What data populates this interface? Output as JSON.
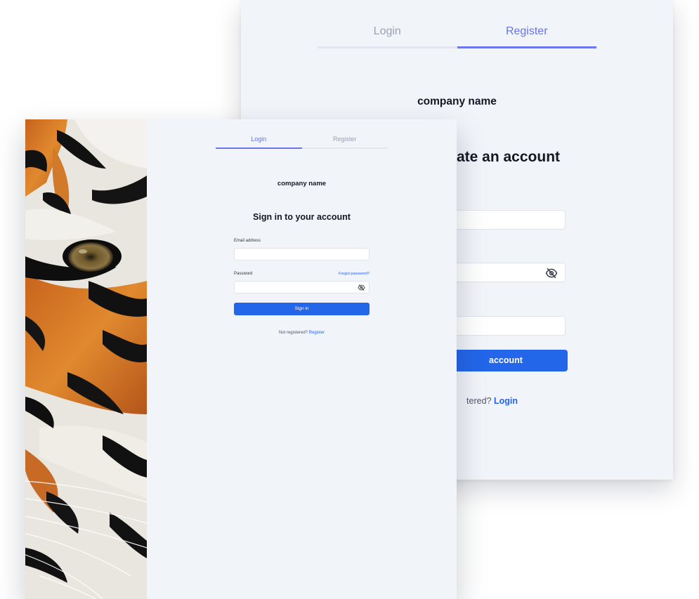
{
  "register_card": {
    "tabs": [
      "Login",
      "Register"
    ],
    "active_tab": "Register",
    "company_name": "company name",
    "heading_visible": "ate an account",
    "button_label_visible": "account",
    "footer_prefix_visible": "tered? ",
    "footer_link": "Login"
  },
  "login_card": {
    "tabs": [
      "Login",
      "Register"
    ],
    "active_tab": "Login",
    "company_name": "company name",
    "heading": "Sign in to your account",
    "email_label": "Email address",
    "password_label": "Password",
    "forgot_password": "Forgot password?",
    "sign_in_button": "Sign in",
    "not_registered": "Not registered? ",
    "register_link": "Register"
  },
  "icons": {
    "password_toggle": "eye-slash-icon"
  },
  "colors": {
    "accent": "#6a78ec",
    "primary_button": "#2466ea",
    "link": "#2563eb",
    "panel_background": "#f1f4f9"
  }
}
